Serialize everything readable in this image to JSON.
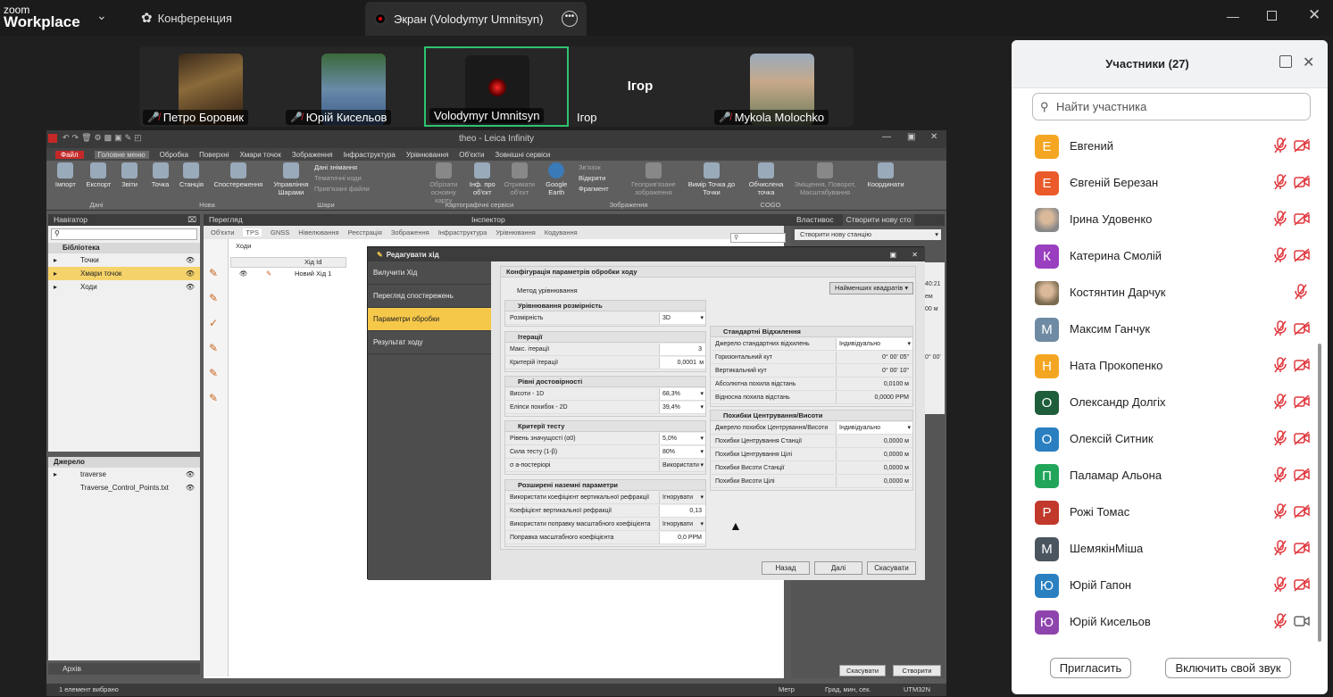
{
  "zoom": {
    "logo_top": "zoom",
    "logo_bottom": "Workplace",
    "meeting_tab": "Конференция",
    "share_tab": "Экран (Volodymyr Umnitsyn)"
  },
  "video_tiles": [
    {
      "name": "Петро Боровик",
      "muted": true
    },
    {
      "name": "Юрій Кисельов",
      "muted": true
    },
    {
      "name": "Volodymyr Umnitsyn",
      "muted": false
    },
    {
      "name": "Ігор",
      "muted": false
    },
    {
      "name": "Mykola Molochko",
      "muted": true
    }
  ],
  "leica": {
    "title": "theo - Leica Infinity",
    "menu": [
      "Файл",
      "Головне меню",
      "Обробка",
      "Поверхні",
      "Хмари точок",
      "Зображення",
      "Інфраструктура",
      "Урівнювання",
      "Об'єкти",
      "Зовнішні сервіси"
    ],
    "ribbon": {
      "import": "Імпорт",
      "export": "Експорт",
      "reports": "Звіти",
      "group_data": "Дані",
      "point": "Точка",
      "station": "Станція",
      "observation": "Спостереження",
      "group_new": "Нова",
      "layers": "Управління Шарами",
      "survey_data": "Дані знімання",
      "thematic_codes": "Тематичні коди",
      "attached_files": "Прив'язані файли",
      "group_layers": "Шари",
      "crop_map": "Обрізати основну карту",
      "info_obj": "Інф. про об'єкт",
      "get_obj": "Отримати об'єкт",
      "google_earth": "Google Earth",
      "group_carto": "Картографічні сервіси",
      "link": "Зв'язок",
      "open": "Відкрити",
      "fragment": "Фрагмент",
      "georef": "Геоприв'язане зображення",
      "group_images": "Зображення",
      "measure": "Вимір Точка до Точки",
      "compute": "Обчислена точка",
      "shift": "Зміщення, Поворот, Масштабування",
      "group_cogo": "COGO",
      "coords": "Координати"
    },
    "navigator": {
      "title": "Навігатор",
      "library": "Бібліотека",
      "items": [
        "Точки",
        "Хмари точок",
        "Ходи"
      ]
    },
    "source": {
      "title": "Джерело",
      "items": [
        "traverse",
        "Traverse_Control_Points.txt"
      ]
    },
    "archive": "Архів",
    "status_left": "1 елемент вибрано",
    "status_right": [
      "Метр",
      "Град, мин, сек.",
      "UTM32N"
    ],
    "view": {
      "title": "Перегляд",
      "tabs": [
        "Об'єкти",
        "TPS",
        "GNSS",
        "Нівелювання",
        "Реєстрація",
        "Зображення",
        "Інфраструктура",
        "Урівнювання",
        "Кодування"
      ],
      "subtab": "Ходи",
      "col_id": "Хід Id",
      "row_id": "Новий Хід 1"
    },
    "inspector": "Інспектор",
    "properties": "Властивос",
    "create_station_tab": "Створити нову сто",
    "create_station": "Створити нову станцію",
    "bottom_cancel": "Скасувати",
    "bottom_create": "Створити",
    "side_vals": [
      "40:21",
      "ем",
      "00 м",
      "0° 00'"
    ]
  },
  "dialog": {
    "title": "Редагувати хід",
    "nav": [
      "Вилучити Хід",
      "Перегляд спостережень",
      "Параметри обробки",
      "Результат ходу"
    ],
    "heading": "Конфігурація параметрів обробки ходу",
    "method_label": "Метод урівнювання",
    "method_value": "Найменших квадратів",
    "adj_dim": {
      "title": "Урівнювання розмірність",
      "label": "Розмірність",
      "value": "3D"
    },
    "iterations": {
      "title": "Ітерації",
      "rows": [
        [
          "Макс. ітерації",
          "3",
          ""
        ],
        [
          "Критерій ітерації",
          "0,0001",
          "м"
        ]
      ]
    },
    "confidence": {
      "title": "Рівні достовірності",
      "rows": [
        [
          "Висоти - 1D",
          "68,3%"
        ],
        [
          "Еліпси похибок - 2D",
          "39,4%"
        ]
      ]
    },
    "test": {
      "title": "Критерії тесту",
      "rows": [
        [
          "Рівень значущості (α0)",
          "5,0%"
        ],
        [
          "Сила тесту (1-β)",
          "80%"
        ],
        [
          "σ a-постеріорі",
          "Використати"
        ]
      ]
    },
    "ext": {
      "title": "Розширені наземні параметри",
      "rows": [
        [
          "Використати коефіцієнт вертикальної рефракції",
          "Ігнорувати"
        ],
        [
          "Коефіцієнт вертикальної рефракції",
          "0,13"
        ],
        [
          "Використати поправку масштабного коефіцієнта",
          "Ігнорувати"
        ],
        [
          "Поправка масштабного коефіцієнта",
          "0,0 PPM"
        ]
      ]
    },
    "std": {
      "title": "Стандартні Відхилення",
      "rows": [
        [
          "Джерело стандартних відхилень",
          "Індивідуально"
        ],
        [
          "Горизонтальний кут",
          "0° 00' 05\""
        ],
        [
          "Вертикальний кут",
          "0° 00' 10\""
        ],
        [
          "Абсолютна похила відстань",
          "0,0100 м"
        ],
        [
          "Відносна похила відстань",
          "0,0000 PPM"
        ]
      ]
    },
    "centering": {
      "title": "Похибки Центрування/Висоти",
      "rows": [
        [
          "Джерело похибок Центрування/Висоти",
          "Індивідуально"
        ],
        [
          "Похибки Центрування Станції",
          "0,0000 м"
        ],
        [
          "Похибки Центрування Цілі",
          "0,0000 м"
        ],
        [
          "Похибки Висоти Станції",
          "0,0000 м"
        ],
        [
          "Похибки Висоти Цілі",
          "0,0000 м"
        ]
      ]
    },
    "btn_back": "Назад",
    "btn_next": "Далі",
    "btn_cancel": "Скасувати"
  },
  "participants": {
    "title": "Участники (27)",
    "search_placeholder": "Найти участника",
    "list": [
      {
        "initial": "Е",
        "name": "Евгений",
        "color": "#f4a623",
        "mic_muted": true,
        "cam_off": true
      },
      {
        "initial": "Е",
        "name": "Євгеній Березан",
        "color": "#ea5a2a",
        "mic_muted": true,
        "cam_off": true
      },
      {
        "initial": "",
        "name": "Ірина Удовенко",
        "color": "#888",
        "photo": true,
        "mic_muted": true,
        "cam_off": true
      },
      {
        "initial": "К",
        "name": "Катерина Смолій",
        "color": "#9a3fbf",
        "mic_muted": true,
        "cam_off": true
      },
      {
        "initial": "",
        "name": "Костянтин Дарчук",
        "color": "#7a6a50",
        "photo": true,
        "mic_muted": true,
        "cam_off": false,
        "no_cam": true
      },
      {
        "initial": "М",
        "name": "Максим Ганчук",
        "color": "#6f8aa3",
        "mic_muted": true,
        "cam_off": true
      },
      {
        "initial": "Н",
        "name": "Ната Прокопенко",
        "color": "#f4a623",
        "mic_muted": true,
        "cam_off": true
      },
      {
        "initial": "О",
        "name": "Олександр Долгіх",
        "color": "#1e5e3a",
        "mic_muted": true,
        "cam_off": true
      },
      {
        "initial": "О",
        "name": "Олексій Ситник",
        "color": "#2a7fc1",
        "mic_muted": true,
        "cam_off": true
      },
      {
        "initial": "П",
        "name": "Паламар Альона",
        "color": "#21a55a",
        "mic_muted": true,
        "cam_off": true
      },
      {
        "initial": "Р",
        "name": "Рожі Томас",
        "color": "#c0392b",
        "mic_muted": true,
        "cam_off": true
      },
      {
        "initial": "М",
        "name": "ШемякінМіша",
        "color": "#4a5560",
        "mic_muted": true,
        "cam_off": true
      },
      {
        "initial": "Ю",
        "name": "Юрій Гапон",
        "color": "#2a7fc1",
        "mic_muted": true,
        "cam_off": true
      },
      {
        "initial": "Ю",
        "name": "Юрій Кисельов",
        "color": "#8e44ad",
        "mic_muted": true,
        "cam_off": false
      }
    ],
    "invite": "Пригласить",
    "unmute": "Включить свой звук"
  }
}
